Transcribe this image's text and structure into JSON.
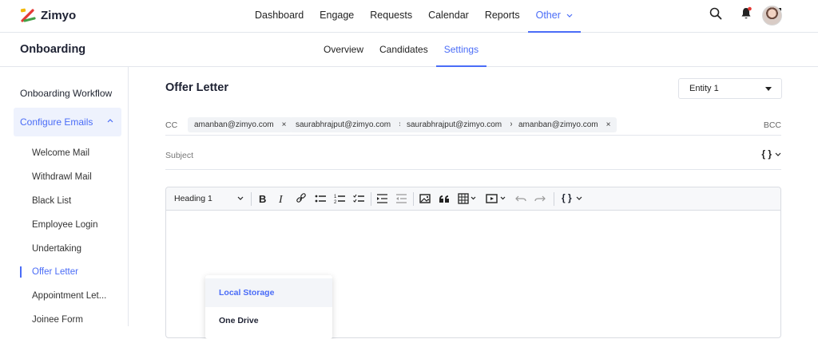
{
  "app": {
    "name": "Zimyo"
  },
  "nav": {
    "items": [
      "Dashboard",
      "Engage",
      "Requests",
      "Calendar",
      "Reports",
      "Other"
    ],
    "active": "Other"
  },
  "page": {
    "title": "Onboarding",
    "tabs": [
      "Overview",
      "Candidates",
      "Settings"
    ],
    "active_tab": "Settings"
  },
  "sidebar": {
    "heading": "Onboarding Workflow",
    "group": "Configure Emails",
    "items": [
      "Welcome Mail",
      "Withdrawl Mail",
      "Black List",
      "Employee Login",
      "Undertaking",
      "Offer Letter",
      "Appointment Let...",
      "Joinee Form"
    ],
    "active_item": "Offer Letter"
  },
  "main": {
    "title": "Offer Letter",
    "entity_selected": "Entity 1",
    "cc_label": "CC",
    "bcc_label": "BCC",
    "cc_chips": [
      "amanban@zimyo.com",
      "saurabhrajput@zimyo.com",
      "saurabhrajput@zimyo.com",
      "amanban@zimyo.com"
    ],
    "chip_remove": "×",
    "subject_placeholder": "Subject",
    "variables_label": "{ }",
    "editor": {
      "heading_select": "Heading 1",
      "variables_label": "{ }"
    },
    "upload_menu": [
      "Local Storage",
      "One Drive"
    ]
  },
  "colors": {
    "accent": "#4a6cf7",
    "text": "#1e2233"
  },
  "icons": [
    "search-icon",
    "bell-icon",
    "apps-grid-icon",
    "avatar"
  ]
}
